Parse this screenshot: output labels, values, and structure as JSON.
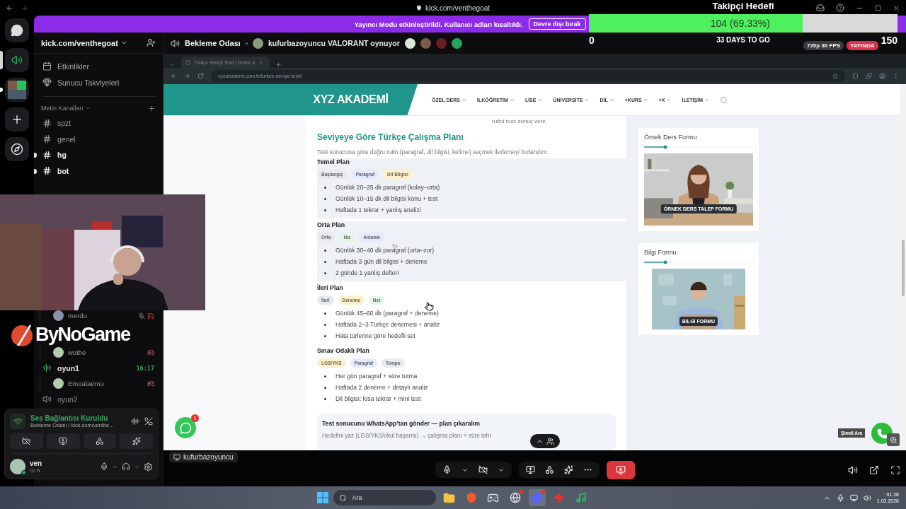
{
  "titlebar": {
    "url": "kick.com/venthegoat"
  },
  "goal": {
    "title": "Takipçi Hedefi",
    "value": "104 (69.33%)",
    "level": 0.6933,
    "min": "0",
    "remaining": "33 DAYS TO GO",
    "max": "150"
  },
  "stream_badges": [
    {
      "label": "720p 30 FPS",
      "kind": "quality"
    },
    {
      "label": "YAYINDA",
      "kind": "live"
    }
  ],
  "banner": {
    "text": "Yayıncı Modu etkinleştirildi. Kullanıcı adları kısaltıldı.",
    "button": "Devre dışı bırak"
  },
  "rail": [
    {
      "kind": "home",
      "selected": false,
      "unread": false
    },
    {
      "kind": "voice-server",
      "selected": true,
      "unread": false
    },
    {
      "kind": "server",
      "selected": false,
      "unread": true
    },
    {
      "kind": "add",
      "selected": false,
      "unread": false
    },
    {
      "kind": "explore",
      "selected": false,
      "unread": false
    }
  ],
  "server": {
    "name": "kick.com/venthegoat"
  },
  "shortcuts": [
    {
      "label": "Etkinlikler",
      "kind": "events"
    },
    {
      "label": "Sunucu Takviyeleri",
      "kind": "boosts"
    }
  ],
  "text_category": "Metin Kanalları",
  "text_channels": [
    {
      "name": "spzt",
      "kind": "thread",
      "unread": false
    },
    {
      "name": "genel",
      "kind": "text",
      "unread": false
    },
    {
      "name": "hg",
      "kind": "text",
      "unread": true
    },
    {
      "name": "bot",
      "kind": "thread",
      "unread": true
    }
  ],
  "voice_rows": [
    {
      "kind": "user",
      "name": "merdo",
      "muted": true,
      "activity": false
    },
    {
      "kind": "user",
      "name": "wothe",
      "muted": false,
      "activity": true
    },
    {
      "kind": "channel",
      "name": "oyun1",
      "active": true,
      "time": "16:17"
    },
    {
      "kind": "user",
      "name": "Emoalaemo",
      "muted": false,
      "activity": true
    },
    {
      "kind": "channel",
      "name": "oyun2",
      "active": false
    }
  ],
  "overlay_logo": "ByNoGame",
  "voice_panel": {
    "status": "Ses Bağlantısı Kuruldu",
    "channel": "Bekleme Odası / kick.com/venthe..."
  },
  "user_panel": {
    "name": "ven",
    "status": "h"
  },
  "header": {
    "channel": "Bekleme Odası",
    "activity": "kufurbazoyuncu VALORANT oynuyor"
  },
  "browser": {
    "tab": "Türkçe Seviye Testi | Online &",
    "url": "xyzakademi.com.tr/turkce-seviye-testi/"
  },
  "site": {
    "logo": "XYZ AKADEMİ",
    "nav": [
      "ÖZEL DERS",
      "İLKÖĞRETİM",
      "LİSE",
      "ÜNİVERSİTE",
      "DİL",
      "+KURS",
      "+X",
      "İLETİŞİM"
    ]
  },
  "article": {
    "previous_text": "rutini hızlı sonuç verir.",
    "title": "Seviyeye Göre Türkçe Çalışma Planı",
    "intro": "Test sonucuna göre doğru rutin (paragraf, dil bilgisi, kelime) seçmek ilerlemeyi hızlandırır.",
    "plans": [
      {
        "title": "Temel Plan",
        "highlighted": true,
        "tags": [
          {
            "label": "Başlangıç",
            "color": "#e8eaee"
          },
          {
            "label": "Paragraf",
            "color": "#e2eafb"
          },
          {
            "label": "Dil Bilgisi",
            "color": "#fcf1cc"
          }
        ],
        "items": [
          "Günlük 20–25 dk paragraf (kolay–orta)",
          "Günlük 10–15 dk dil bilgisi konu + test",
          "Haftada 1 tekrar + yanlış analizi"
        ]
      },
      {
        "title": "Orta Plan",
        "highlighted": true,
        "tags": [
          {
            "label": "Orta",
            "color": "#e8eaee"
          },
          {
            "label": "Hız",
            "color": "#e3f6e5"
          },
          {
            "label": "Anlama",
            "color": "#e2eafb"
          }
        ],
        "items": [
          "Günlük 30–40 dk paragraf (orta–zor)",
          "Haftada 3 gün dil bilgisi + deneme",
          "2 günde 1 yanlış defteri"
        ]
      },
      {
        "title": "İleri Plan",
        "highlighted": false,
        "tags": [
          {
            "label": "İleri",
            "color": "#e8eaee"
          },
          {
            "label": "Deneme",
            "color": "#fcf1cc"
          },
          {
            "label": "Net",
            "color": "#e3f6e5"
          }
        ],
        "items": [
          "Günlük 45–60 dk (paragraf + deneme)",
          "Haftada 2–3 Türkçe denemesi + analiz",
          "Hata türlerine göre hedefli set"
        ]
      },
      {
        "title": "Sınav Odaklı Plan",
        "highlighted": false,
        "tags": [
          {
            "label": "LGS/YKS",
            "color": "#fcf1cc"
          },
          {
            "label": "Paragraf",
            "color": "#e2eafb"
          },
          {
            "label": "Tempo",
            "color": "#e8eaee"
          }
        ],
        "items": [
          "Her gün paragraf + süre tutma",
          "Haftada 2 deneme + detaylı analiz",
          "Dil bilgisi: kısa tekrar + mini test"
        ]
      }
    ],
    "cta": {
      "title": "Test sonucunu WhatsApp’tan gönder — plan çıkaralım",
      "text": "Hedefini yaz (LGS/YKS/okul başarısı) → çalışma planı + süre tahr"
    }
  },
  "forms": [
    {
      "title": "Örnek Ders Formu",
      "image_label": "ÖRNEK DERS TALEP FORMU",
      "kind": "picture"
    },
    {
      "title": "Bilgi Formu",
      "image_label": "BİLGİ FORMU",
      "kind": "picture"
    }
  ],
  "floating": {
    "whatsapp_badge": "1",
    "call_label": "Şimdi Ara"
  },
  "stream_bar": {
    "streamer": "kufurbazoyuncu"
  },
  "taskbar": {
    "search": "Ara",
    "time": "01:28",
    "date": "1.03.2026",
    "apps": [
      {
        "kind": "files",
        "selected": false,
        "notification": false
      },
      {
        "kind": "brave",
        "selected": false,
        "notification": false
      },
      {
        "kind": "steam",
        "selected": false,
        "notification": false
      },
      {
        "kind": "browser",
        "selected": false,
        "notification": true
      },
      {
        "kind": "discord",
        "selected": true,
        "notification": true
      },
      {
        "kind": "red-app",
        "selected": false,
        "notification": false
      },
      {
        "kind": "music",
        "selected": false,
        "notification": false
      }
    ]
  }
}
